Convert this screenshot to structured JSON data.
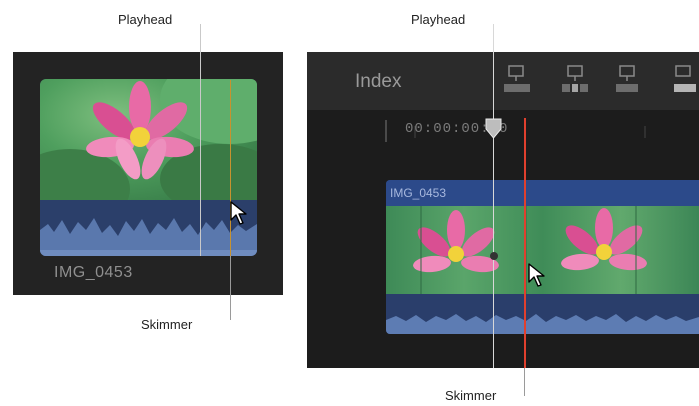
{
  "left_callouts": {
    "playhead": "Playhead",
    "skimmer": "Skimmer"
  },
  "left_clip": {
    "name": "IMG_0453"
  },
  "right_callouts": {
    "playhead": "Playhead",
    "skimmer": "Skimmer"
  },
  "timeline": {
    "index_label": "Index",
    "timecode": "00:00:00:00",
    "clip_name": "IMG_0453"
  },
  "colors": {
    "playhead": "#c9c9c9",
    "skimmer_left": "#c7922f",
    "skimmer_right": "#e0402e",
    "clip_blue": "#2e4a86",
    "panel_bg": "#1c1c1c"
  },
  "icons": [
    "append-clip-icon",
    "insert-clip-icon",
    "connect-clip-icon",
    "overwrite-clip-icon",
    "pointer-cursor-icon",
    "lotus-flower-thumbnail"
  ]
}
